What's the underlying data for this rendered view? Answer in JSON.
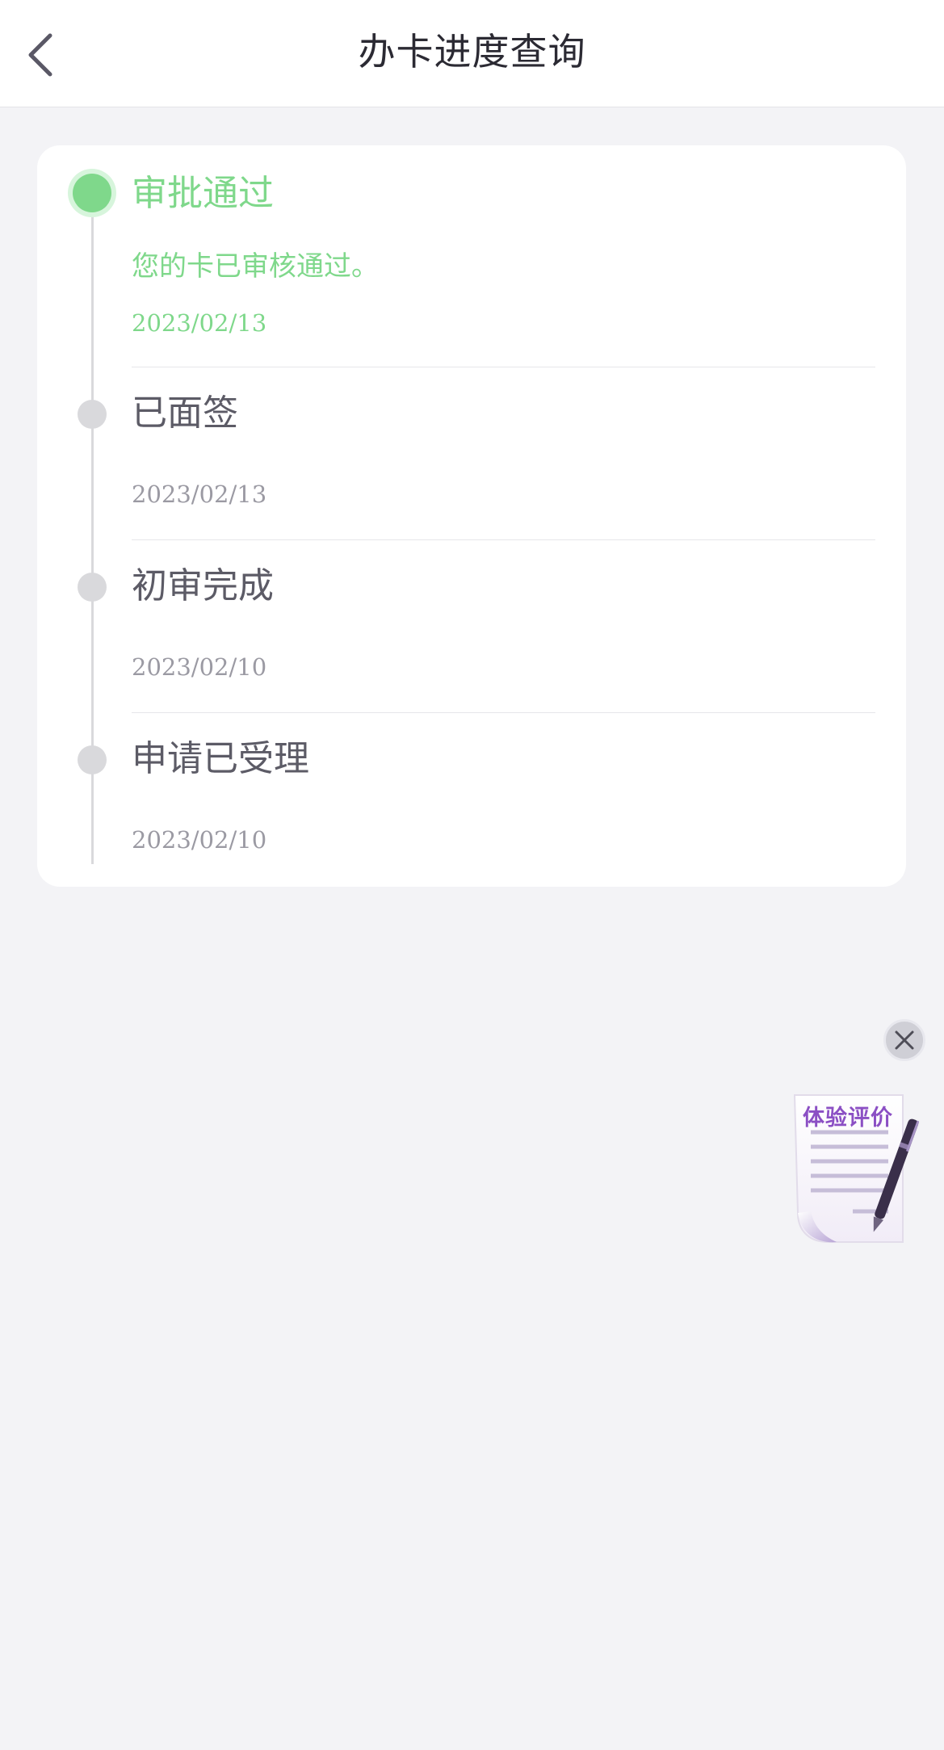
{
  "header": {
    "title": "办卡进度查询"
  },
  "timeline": [
    {
      "title": "审批通过",
      "description": "您的卡已审核通过。",
      "date": "2023/02/13",
      "status": "active"
    },
    {
      "title": "已面签",
      "date": "2023/02/13",
      "status": "done"
    },
    {
      "title": "初审完成",
      "date": "2023/02/10",
      "status": "done"
    },
    {
      "title": "申请已受理",
      "date": "2023/02/10",
      "status": "done"
    }
  ],
  "floating": {
    "eval_label": "体验评价"
  },
  "icons": {
    "back": "chevron-left-icon",
    "close": "close-icon",
    "evaluation": "document-pen-icon"
  },
  "colors": {
    "accent_green": "#7fd88b",
    "inactive_gray": "#d9d9dc",
    "title_text": "#2b2a33",
    "eval_purple": "#8b4fc4"
  }
}
